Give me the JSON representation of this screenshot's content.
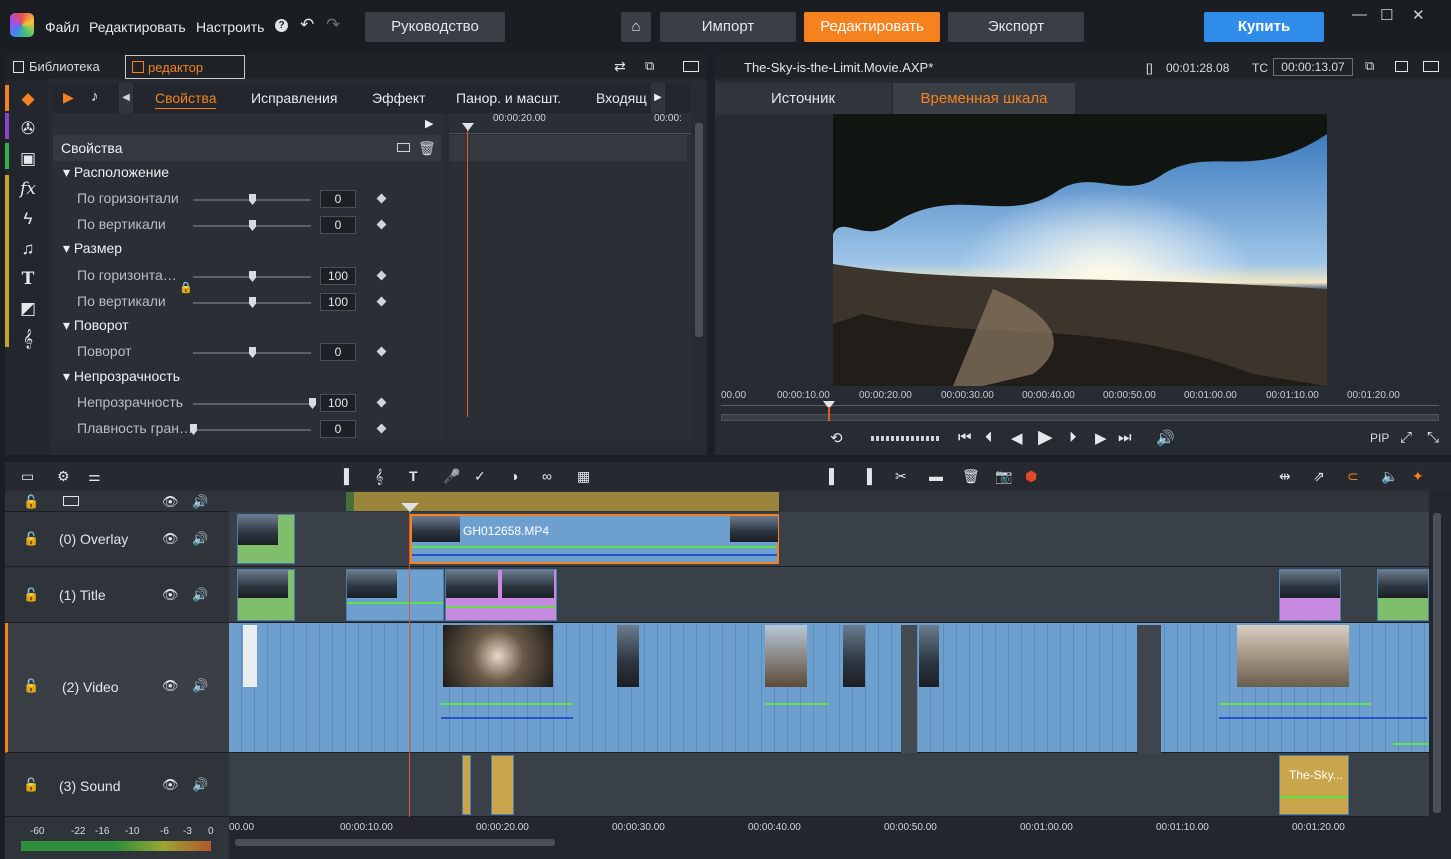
{
  "menu": {
    "file": "Файл",
    "edit": "Редактировать",
    "settings": "Настроить"
  },
  "top_buttons": {
    "guide": "Руководство",
    "import": "Импорт",
    "edit": "Редактировать",
    "export": "Экспорт",
    "buy": "Купить"
  },
  "left_tabs": {
    "library": "Библиотека",
    "editor": "редактор"
  },
  "prop_tabs": [
    "Свойства",
    "Исправления",
    "Эффект",
    "Панор. и масшт.",
    "Входящ"
  ],
  "props": {
    "header": "Свойства",
    "groups": {
      "position": "Расположение",
      "size": "Размер",
      "rotation": "Поворот",
      "opacity": "Непрозрачность"
    },
    "params": [
      {
        "label": "По горизонтали",
        "value": "0"
      },
      {
        "label": "По вертикали",
        "value": "0"
      },
      {
        "label": "По горизонта…",
        "value": "100"
      },
      {
        "label": "По вертикали",
        "value": "100"
      },
      {
        "label": "Поворот",
        "value": "0"
      },
      {
        "label": "Непрозрачность",
        "value": "100"
      },
      {
        "label": "Плавность гран…",
        "value": "0"
      }
    ]
  },
  "mini_timeline": {
    "t1": "00:00:20.00",
    "t2": "00:00:"
  },
  "preview": {
    "project_title": "The-Sky-is-the-Limit.Movie.AXP*",
    "bracket": "[]",
    "duration": "00:01:28.08",
    "tc_label": "TC",
    "timecode": "00:00:13.07",
    "tab_source": "Источник",
    "tab_timeline": "Временная шкала",
    "ruler": [
      "00.00",
      "00:00:10.00",
      "00:00:20.00",
      "00:00:30.00",
      "00:00:40.00",
      "00:00:50.00",
      "00:01:00.00",
      "00:01:10.00",
      "00:01:20.00"
    ],
    "pip": "PIP"
  },
  "tracks": [
    {
      "name": "(0) Overlay"
    },
    {
      "name": "(1) Title"
    },
    {
      "name": "(2) Video"
    },
    {
      "name": "(3) Sound"
    }
  ],
  "clips": {
    "overlay_clip": "GH012658.MP4",
    "sound_clip": "The-Sky..."
  },
  "timeline_ticks": [
    "00.00",
    "00:00:10.00",
    "00:00:20.00",
    "00:00:30.00",
    "00:00:40.00",
    "00:00:50.00",
    "00:01:00.00",
    "00:01:10.00",
    "00:01:20.00"
  ],
  "meter_ticks": [
    "-60",
    "-22",
    "-16",
    "-10",
    "-6",
    "-3",
    "0"
  ],
  "colors": {
    "accent": "#f5821f",
    "buy": "#2f8ce8",
    "video_clip": "#6ea0cf",
    "title_clip": "#c68be0",
    "sound_clip": "#c9a64c"
  }
}
